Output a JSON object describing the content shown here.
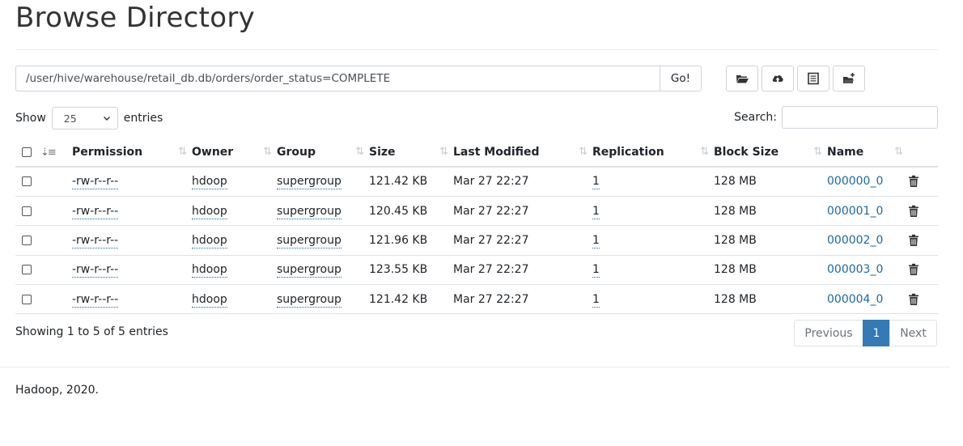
{
  "page": {
    "title": "Browse Directory"
  },
  "pathbar": {
    "path": "/user/hive/warehouse/retail_db.db/orders/order_status=COMPLETE",
    "go_label": "Go!"
  },
  "toolbar": {
    "icons": [
      "folder-open-icon",
      "cloud-upload-icon",
      "list-alt-icon",
      "create-directory-icon"
    ]
  },
  "controls": {
    "show_label": "Show",
    "entries_value": "25",
    "entries_label": "entries",
    "search_label": "Search:"
  },
  "table": {
    "columns": [
      "Permission",
      "Owner",
      "Group",
      "Size",
      "Last Modified",
      "Replication",
      "Block Size",
      "Name"
    ],
    "rows": [
      {
        "permission": "-rw-r--r--",
        "owner": "hdoop",
        "group": "supergroup",
        "size": "121.42 KB",
        "modified": "Mar 27 22:27",
        "replication": "1",
        "block_size": "128 MB",
        "name": "000000_0"
      },
      {
        "permission": "-rw-r--r--",
        "owner": "hdoop",
        "group": "supergroup",
        "size": "120.45 KB",
        "modified": "Mar 27 22:27",
        "replication": "1",
        "block_size": "128 MB",
        "name": "000001_0"
      },
      {
        "permission": "-rw-r--r--",
        "owner": "hdoop",
        "group": "supergroup",
        "size": "121.96 KB",
        "modified": "Mar 27 22:27",
        "replication": "1",
        "block_size": "128 MB",
        "name": "000002_0"
      },
      {
        "permission": "-rw-r--r--",
        "owner": "hdoop",
        "group": "supergroup",
        "size": "123.55 KB",
        "modified": "Mar 27 22:27",
        "replication": "1",
        "block_size": "128 MB",
        "name": "000003_0"
      },
      {
        "permission": "-rw-r--r--",
        "owner": "hdoop",
        "group": "supergroup",
        "size": "121.42 KB",
        "modified": "Mar 27 22:27",
        "replication": "1",
        "block_size": "128 MB",
        "name": "000004_0"
      }
    ]
  },
  "info": "Showing 1 to 5 of 5 entries",
  "pagination": {
    "previous": "Previous",
    "current": "1",
    "next": "Next"
  },
  "footer": "Hadoop, 2020.",
  "colors": {
    "link": "#1a6aa6",
    "active_page": "#337ab7"
  }
}
